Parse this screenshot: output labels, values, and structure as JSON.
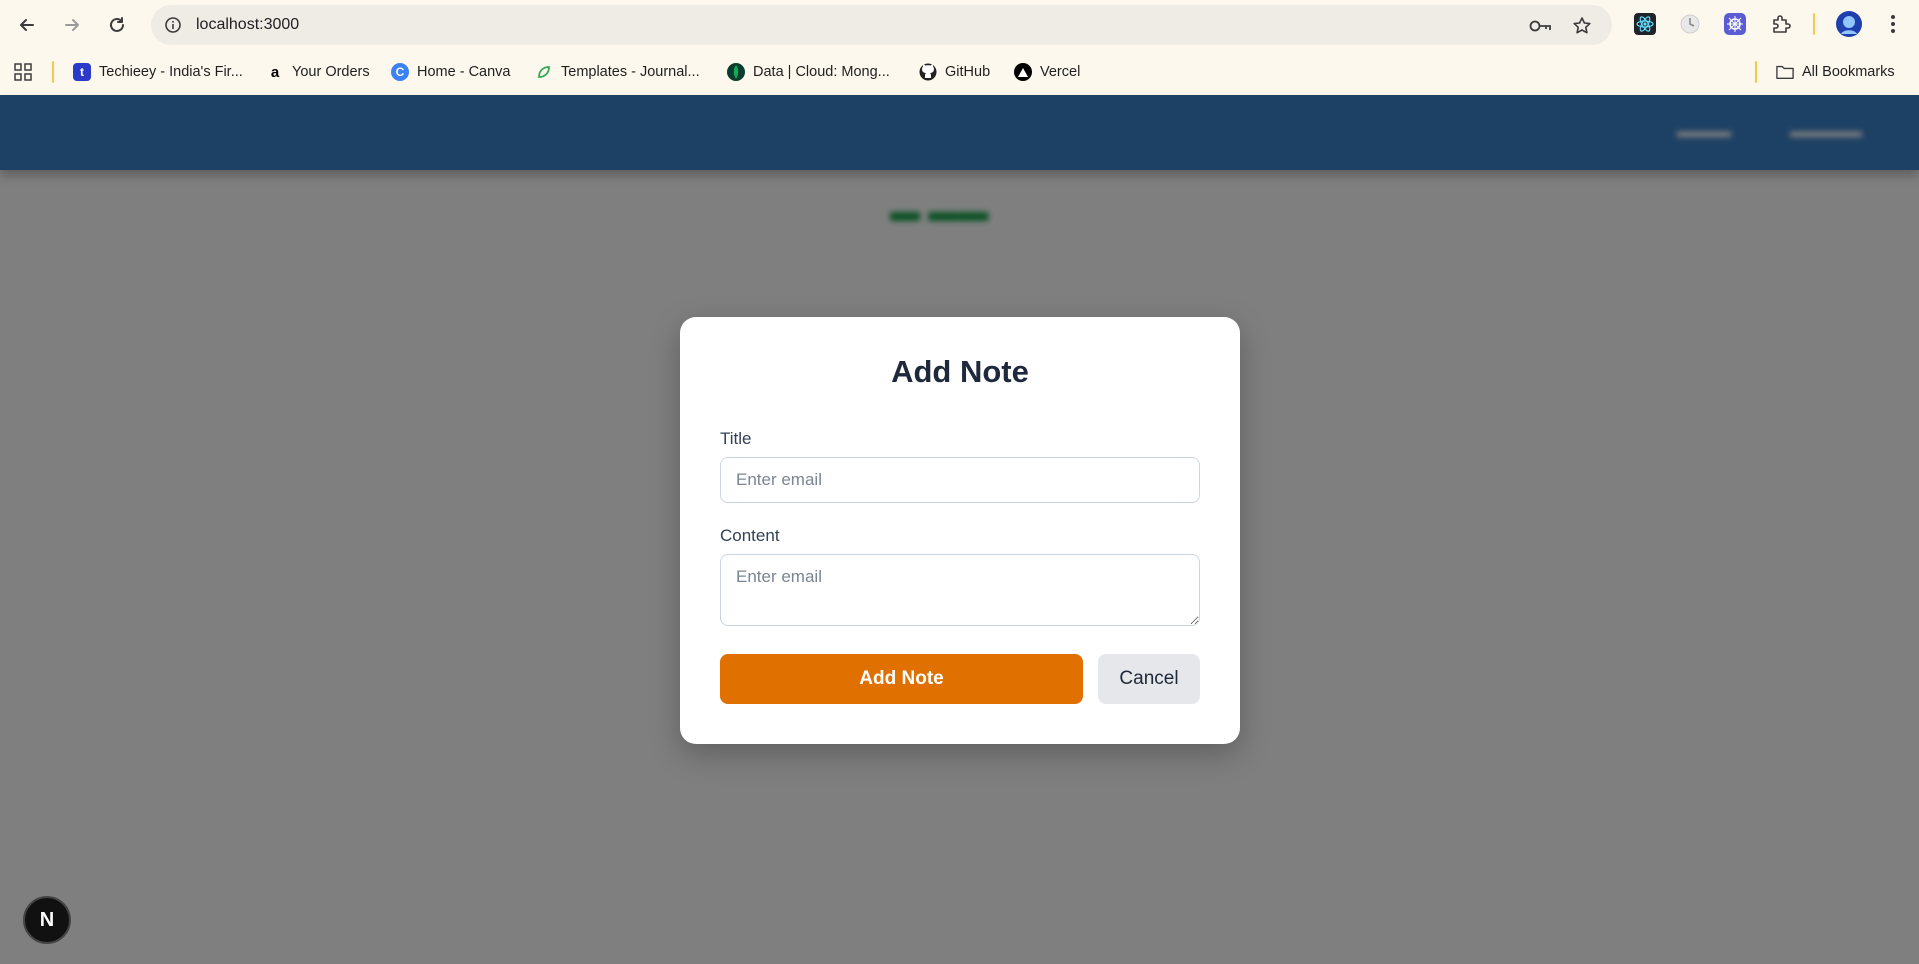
{
  "browser": {
    "url": "localhost:3000",
    "bookmarks": [
      {
        "label": "Techieey - India's Fir...",
        "icon": "techieey-icon",
        "color": "#2b3ac7",
        "glyph": "t"
      },
      {
        "label": "Your Orders",
        "icon": "amazon-icon",
        "color": "#000000",
        "glyph": "a"
      },
      {
        "label": "Home - Canva",
        "icon": "canva-icon",
        "color": "#3b82f6",
        "glyph": "C"
      },
      {
        "label": "Templates - Journal...",
        "icon": "journal-leaf-icon",
        "color": "#34a853",
        "glyph": ""
      },
      {
        "label": "Data | Cloud: Mong...",
        "icon": "mongodb-icon",
        "color": "#0b3d2e",
        "glyph": ""
      },
      {
        "label": "GitHub",
        "icon": "github-icon",
        "color": "#222222",
        "glyph": ""
      },
      {
        "label": "Vercel",
        "icon": "vercel-icon",
        "color": "#000000",
        "glyph": ""
      }
    ],
    "all_bookmarks_label": "All Bookmarks"
  },
  "modal": {
    "title": "Add Note",
    "title_label": "Title",
    "title_placeholder": "Enter email",
    "content_label": "Content",
    "content_placeholder": "Enter email",
    "submit_label": "Add Note",
    "cancel_label": "Cancel"
  },
  "nextjs_badge": "N",
  "colors": {
    "primary_button": "#e07000",
    "header": "#3b82c9",
    "overlay": "rgba(0,0,0,0.5)"
  }
}
